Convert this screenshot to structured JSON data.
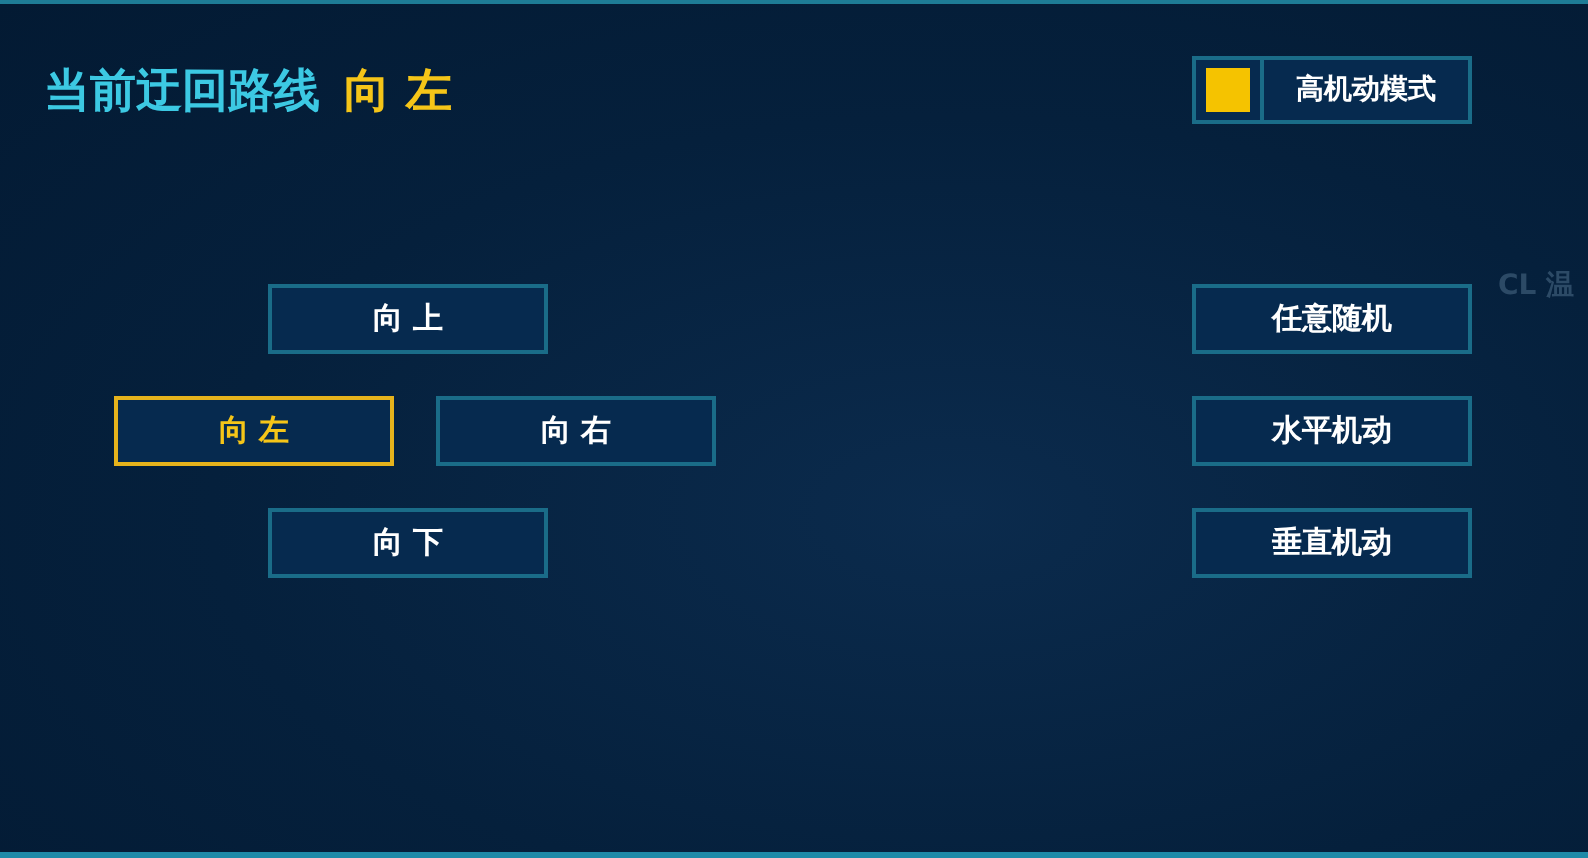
{
  "header": {
    "title": "当前迂回路线",
    "current_route": "向 左"
  },
  "high_mobility_mode": {
    "label": "高机动模式",
    "checked": true
  },
  "directions": [
    {
      "label": "向 上",
      "kind": "up",
      "selected": false
    },
    {
      "label": "向 左",
      "kind": "left",
      "selected": true
    },
    {
      "label": "向 右",
      "kind": "right",
      "selected": false
    },
    {
      "label": "向 下",
      "kind": "down",
      "selected": false
    }
  ],
  "maneuvers": [
    {
      "label": "任意随机"
    },
    {
      "label": "水平机动"
    },
    {
      "label": "垂直机动"
    }
  ],
  "background_text": "CL 温"
}
